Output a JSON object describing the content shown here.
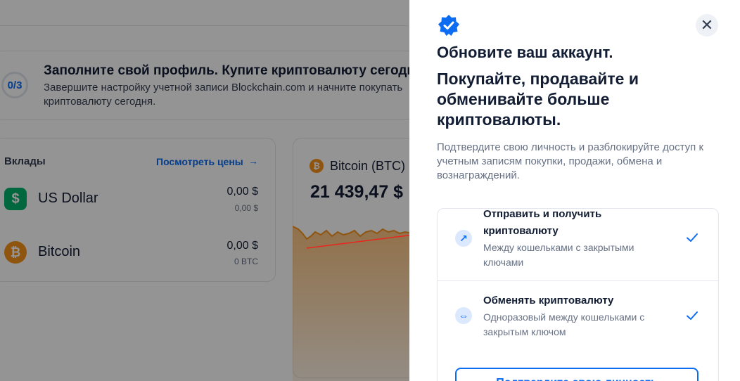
{
  "profile": {
    "progress": "0/3",
    "title": "Заполните свой профиль. Купите криптовалюту сегодня.",
    "subtitle": "Завершите настройку учетной записи Blockchain.com и начните покупать криптовалюту сегодня."
  },
  "deposits": {
    "title": "Вклады",
    "prices_link": "Посмотреть цены",
    "prices_arrow": "→",
    "assets": [
      {
        "name": "US Dollar",
        "symbol": "$",
        "fiat": "0,00 $",
        "crypto": "0,00 $",
        "icon": "dollar-icon",
        "color": "#00b26b"
      },
      {
        "name": "Bitcoin",
        "symbol": "₿",
        "fiat": "0,00 $",
        "crypto": "0 BTC",
        "icon": "bitcoin-icon",
        "color": "#f7931a"
      }
    ]
  },
  "chart_card": {
    "coin_label": "Bitcoin (BTC)",
    "price": "21 439,47 $"
  },
  "flyout": {
    "title": "Обновите ваш аккаунт.",
    "headline": "Покупайте, продавайте и обменивайте больше криптовалюты.",
    "description": "Подтвердите свою личность и разблокируйте доступ к учетным записям покупки, продажи, обмена и вознаграждений.",
    "close_glyph": "✕",
    "features": [
      {
        "title": "Отправить и получить криптовалюту",
        "subtitle": "Между кошельками с закрытыми ключами",
        "icon": "arrow-up-right-icon",
        "glyph": "↗"
      },
      {
        "title": "Обменять криптовалюту",
        "subtitle": "Одноразовый между кошельками с закрытым ключом",
        "icon": "swap-icon",
        "glyph": "⇔"
      }
    ],
    "cta_label": "Подтвердите свою личность"
  },
  "colors": {
    "accent": "#0c6cf2",
    "bitcoin": "#f7931a",
    "usd": "#00b26b",
    "annotation_arrow": "#e8261c"
  }
}
